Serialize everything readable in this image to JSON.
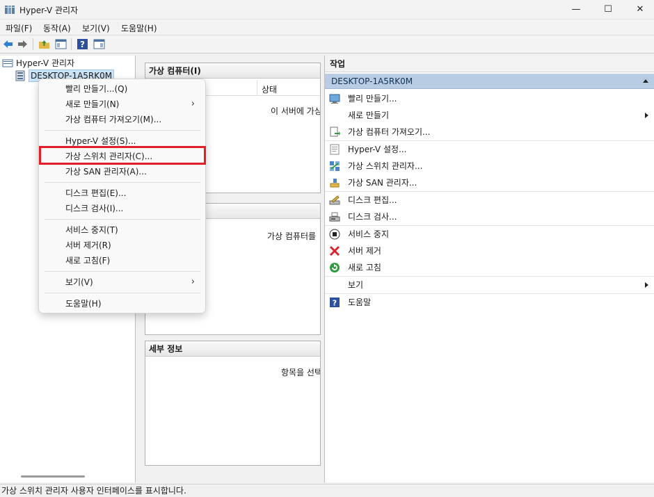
{
  "window": {
    "title": "Hyper-V 관리자",
    "min_glyph": "—",
    "max_glyph": "☐",
    "close_glyph": "✕"
  },
  "menubar": {
    "items": [
      "파일(F)",
      "동작(A)",
      "보기(V)",
      "도움말(H)"
    ]
  },
  "toolbar": {
    "icons": [
      "back-icon",
      "forward-icon",
      "up-folder-icon",
      "show-tree-icon",
      "help-icon",
      "show-action-pane-icon"
    ]
  },
  "tree": {
    "root_label": "Hyper-V 관리자",
    "server_label": "DESKTOP-1A5RK0M"
  },
  "center": {
    "vm_panel_title": "가상 컴퓨터(I)",
    "vm_col_state": "상태",
    "vm_empty_msg": "이 서버에 가상",
    "checkpoint_msg": "가상 컴퓨터를",
    "details_title": "세부 정보",
    "details_msg": "항목을 선택"
  },
  "actions": {
    "pane_title": "작업",
    "group_label": "DESKTOP-1A5RK0M",
    "items": [
      {
        "label": "빨리 만들기...",
        "icon": "quick-create-icon",
        "submenu": false
      },
      {
        "label": "새로 만들기",
        "icon": "",
        "submenu": true
      },
      {
        "label": "가상 컴퓨터 가져오기...",
        "icon": "import-vm-icon",
        "submenu": false
      },
      {
        "label": "Hyper-V 설정...",
        "icon": "hyperv-settings-icon",
        "submenu": false
      },
      {
        "label": "가상 스위치 관리자...",
        "icon": "virtual-switch-icon",
        "submenu": false
      },
      {
        "label": "가상 SAN 관리자...",
        "icon": "virtual-san-icon",
        "submenu": false
      },
      {
        "label": "디스크 편집...",
        "icon": "edit-disk-icon",
        "submenu": false
      },
      {
        "label": "디스크 검사...",
        "icon": "inspect-disk-icon",
        "submenu": false
      },
      {
        "label": "서비스 중지",
        "icon": "stop-service-icon",
        "submenu": false
      },
      {
        "label": "서버 제거",
        "icon": "remove-server-icon",
        "submenu": false
      },
      {
        "label": "새로 고침",
        "icon": "refresh-icon",
        "submenu": false
      },
      {
        "label": "보기",
        "icon": "",
        "submenu": true
      },
      {
        "label": "도움말",
        "icon": "help-icon",
        "submenu": false
      }
    ]
  },
  "context_menu": {
    "items": [
      {
        "label": "빨리 만들기...(Q)",
        "submenu": false
      },
      {
        "label": "새로 만들기(N)",
        "submenu": true
      },
      {
        "label": "가상 컴퓨터 가져오기(M)...",
        "submenu": false
      },
      {
        "label": "Hyper-V 설정(S)...",
        "submenu": false
      },
      {
        "label": "가상 스위치 관리자(C)...",
        "submenu": false,
        "highlighted": true
      },
      {
        "label": "가상 SAN 관리자(A)...",
        "submenu": false
      },
      {
        "label": "디스크 편집(E)...",
        "submenu": false
      },
      {
        "label": "디스크 검사(I)...",
        "submenu": false
      },
      {
        "label": "서비스 중지(T)",
        "submenu": false
      },
      {
        "label": "서버 제거(R)",
        "submenu": false
      },
      {
        "label": "새로 고침(F)",
        "submenu": false
      },
      {
        "label": "보기(V)",
        "submenu": true
      },
      {
        "label": "도움말(H)",
        "submenu": false
      }
    ],
    "submenu_glyph": "›",
    "highlight_color": "#e41e28"
  },
  "statusbar": {
    "text": "가상 스위치 관리자 사용자 인터페이스를 표시합니다."
  },
  "colors": {
    "accent_group": "#b8cce4",
    "tree_selection": "#cce4f7"
  }
}
